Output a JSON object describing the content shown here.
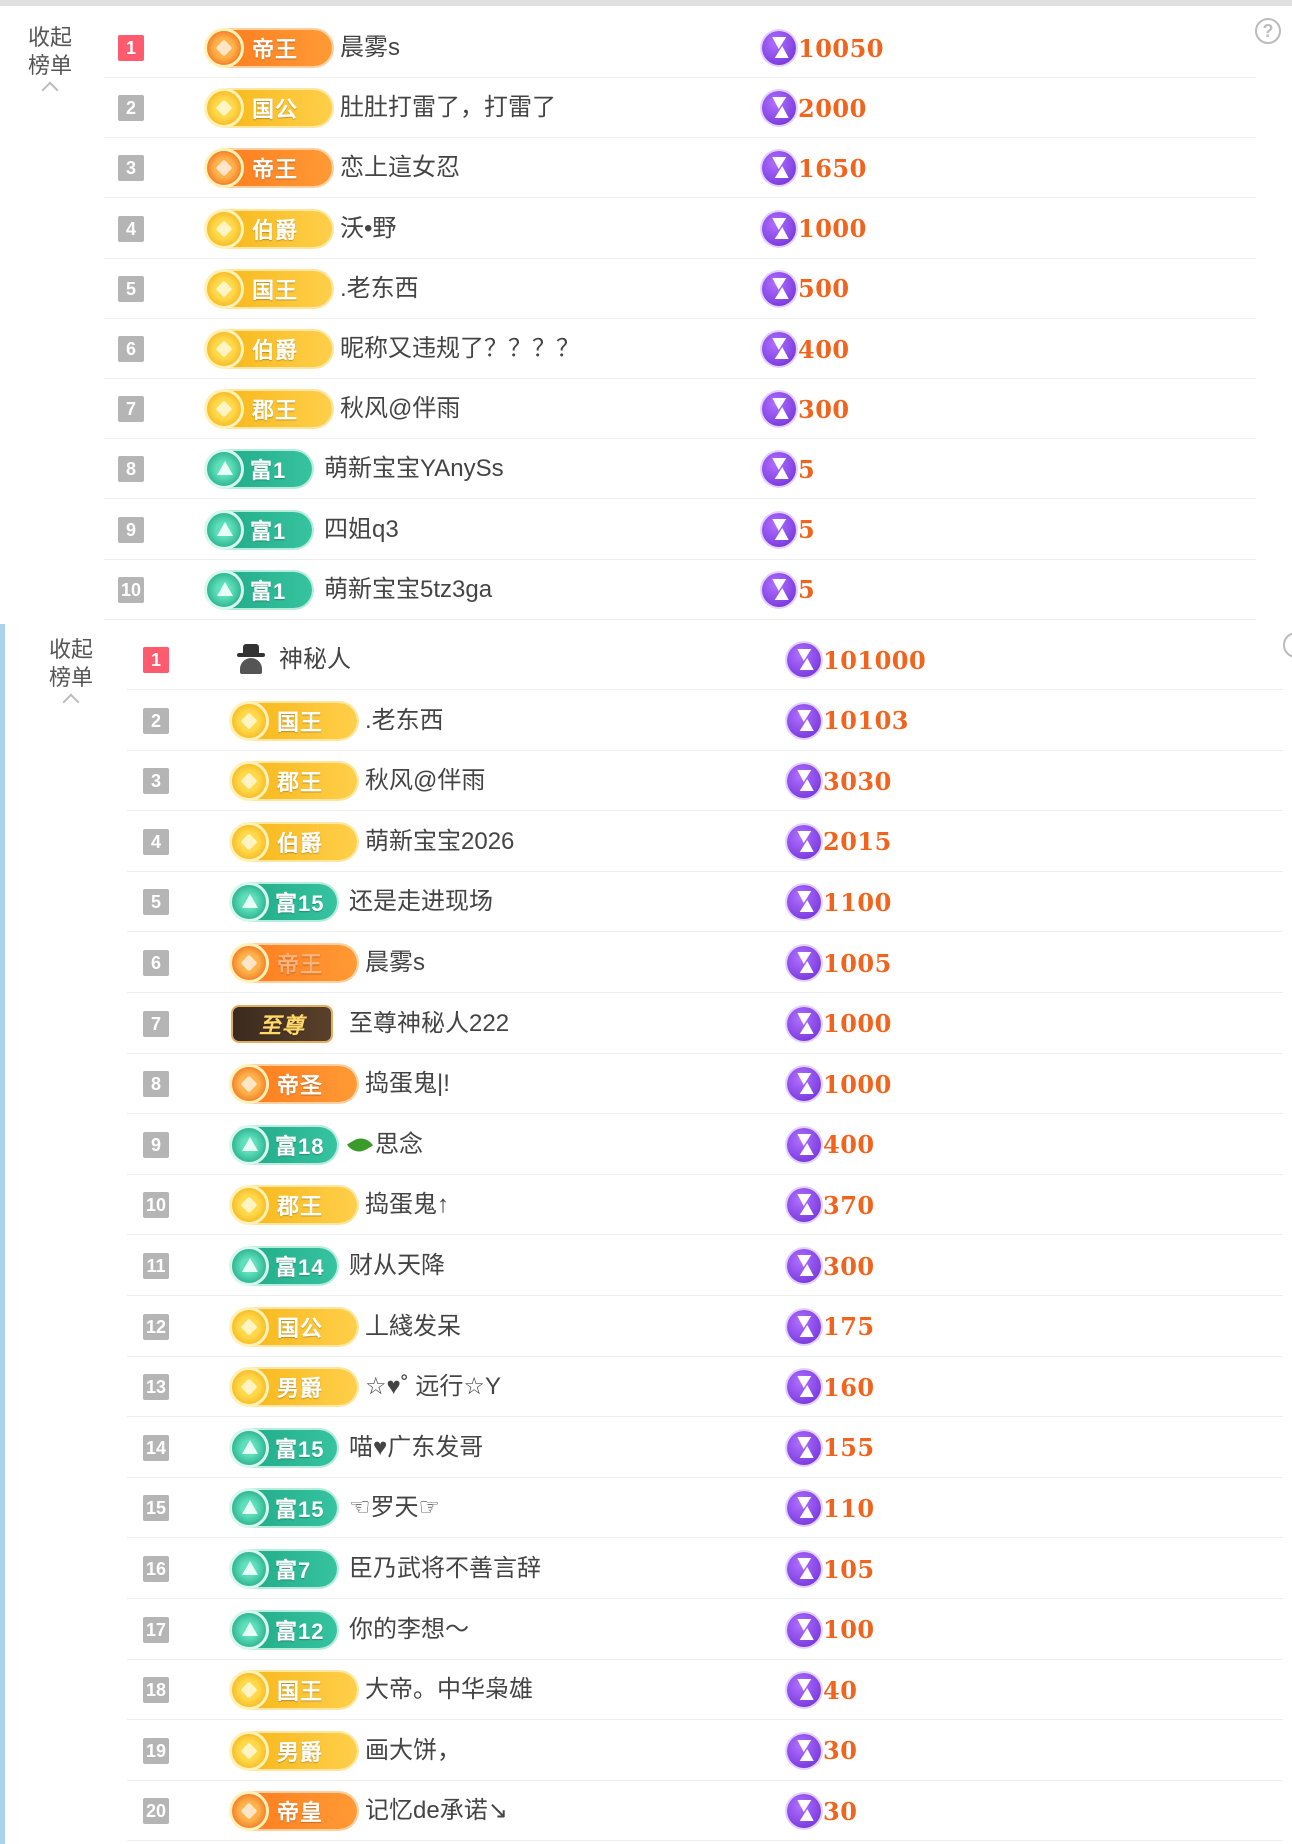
{
  "panel1": {
    "collapse_label": "收起\n榜单",
    "help_glyph": "?",
    "rows": [
      {
        "rank": "1",
        "badge": "帝王",
        "badge_style": "orange",
        "name": "晨雾s",
        "score": "10050"
      },
      {
        "rank": "2",
        "badge": "国公",
        "badge_style": "gold",
        "name": "肚肚打雷了，打雷了",
        "score": "2000"
      },
      {
        "rank": "3",
        "badge": "帝王",
        "badge_style": "orange",
        "name": "恋上這女忍",
        "score": "1650"
      },
      {
        "rank": "4",
        "badge": "伯爵",
        "badge_style": "gold",
        "name": "沃•野",
        "score": "1000"
      },
      {
        "rank": "5",
        "badge": "国王",
        "badge_style": "gold",
        "name": ".老东西",
        "score": "500"
      },
      {
        "rank": "6",
        "badge": "伯爵",
        "badge_style": "gold",
        "name": "昵称又违规了？？？？",
        "score": "400"
      },
      {
        "rank": "7",
        "badge": "郡王",
        "badge_style": "gold",
        "name": "秋风@伴雨",
        "score": "300"
      },
      {
        "rank": "8",
        "badge": "富1",
        "badge_style": "green",
        "name": "萌新宝宝YAnySs",
        "score": "5"
      },
      {
        "rank": "9",
        "badge": "富1",
        "badge_style": "green",
        "name": "四姐q3",
        "score": "5"
      },
      {
        "rank": "10",
        "badge": "富1",
        "badge_style": "green",
        "name": "萌新宝宝5tz3ga",
        "score": "5"
      }
    ]
  },
  "panel2": {
    "collapse_label": "收起\n榜单",
    "rows": [
      {
        "rank": "1",
        "badge": "",
        "badge_style": "mystery",
        "name": "神秘人",
        "score": "101000"
      },
      {
        "rank": "2",
        "badge": "国王",
        "badge_style": "gold",
        "name": ".老东西",
        "score": "10103"
      },
      {
        "rank": "3",
        "badge": "郡王",
        "badge_style": "gold",
        "name": "秋风@伴雨",
        "score": "3030"
      },
      {
        "rank": "4",
        "badge": "伯爵",
        "badge_style": "gold",
        "name": "萌新宝宝2026",
        "score": "2015"
      },
      {
        "rank": "5",
        "badge": "富15",
        "badge_style": "green",
        "name": "还是走进现场",
        "score": "1100"
      },
      {
        "rank": "6",
        "badge": "帝王",
        "badge_style": "orange faded",
        "name": "晨雾s",
        "score": "1005"
      },
      {
        "rank": "7",
        "badge": "至尊",
        "badge_style": "dark",
        "name": "至尊神秘人222",
        "score": "1000"
      },
      {
        "rank": "8",
        "badge": "帝圣",
        "badge_style": "orange",
        "name": "捣蛋鬼|!",
        "score": "1000"
      },
      {
        "rank": "9",
        "badge": "富18",
        "badge_style": "green",
        "name": "思念",
        "leaf": true,
        "score": "400"
      },
      {
        "rank": "10",
        "badge": "郡王",
        "badge_style": "gold",
        "name": "捣蛋鬼↑",
        "score": "370"
      },
      {
        "rank": "11",
        "badge": "富14",
        "badge_style": "green",
        "name": "财从天降",
        "score": "300"
      },
      {
        "rank": "12",
        "badge": "国公",
        "badge_style": "gold",
        "name": "丄綫发呆",
        "score": "175"
      },
      {
        "rank": "13",
        "badge": "男爵",
        "badge_style": "gold",
        "name": "☆♥˚  远行☆Y",
        "score": "160"
      },
      {
        "rank": "14",
        "badge": "富15",
        "badge_style": "green",
        "name": "喵♥广东发哥",
        "score": "155"
      },
      {
        "rank": "15",
        "badge": "富15",
        "badge_style": "green",
        "name": "☜罗天☞",
        "score": "110"
      },
      {
        "rank": "16",
        "badge": "富7",
        "badge_style": "green",
        "name": "臣乃武将不善言辞",
        "score": "105"
      },
      {
        "rank": "17",
        "badge": "富12",
        "badge_style": "green",
        "name": "你的李想～",
        "score": "100"
      },
      {
        "rank": "18",
        "badge": "国王",
        "badge_style": "gold",
        "name": "大帝。中华枭雄",
        "score": "40"
      },
      {
        "rank": "19",
        "badge": "男爵",
        "badge_style": "gold",
        "name": "画大饼，",
        "score": "30"
      },
      {
        "rank": "20",
        "badge": "帝皇",
        "badge_style": "orange",
        "name": "记忆de承诺↘",
        "score": "30"
      }
    ]
  },
  "colors": {
    "score": "#f0641e",
    "rank_first": "#ff5a6e",
    "rank_other": "#b5b5b5",
    "panel2_accent": "#a9d4ec"
  },
  "icons": {
    "score": "lightning-coin-icon",
    "help": "question-icon",
    "collapse": "chevron-up-icon"
  }
}
